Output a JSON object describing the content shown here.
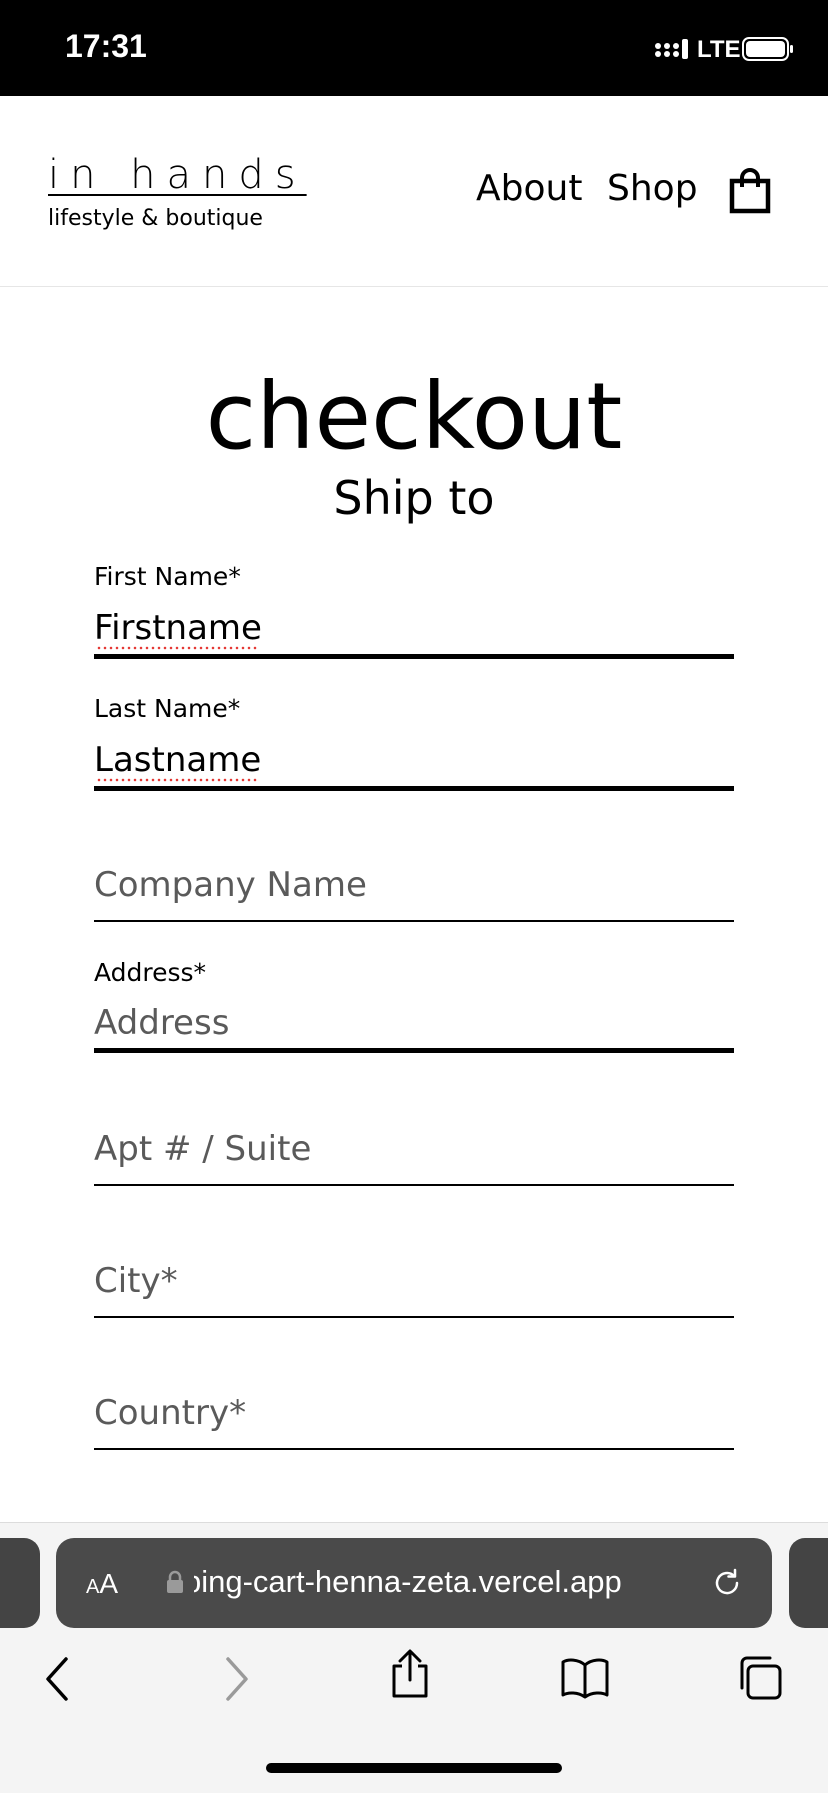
{
  "status_bar": {
    "time": "17:31",
    "network": "LTE"
  },
  "header": {
    "logo_title": "in hands",
    "logo_subtitle": "lifestyle & boutique",
    "nav": {
      "about": "About",
      "shop": "Shop"
    },
    "cart_icon": "shopping-bag-icon"
  },
  "main": {
    "title": "checkout",
    "subtitle": "Ship to",
    "fields": {
      "first_name": {
        "label": "First Name*",
        "value": "Firstname"
      },
      "last_name": {
        "label": "Last Name*",
        "value": "Lastname"
      },
      "company": {
        "placeholder": "Company Name"
      },
      "address": {
        "label": "Address*",
        "placeholder": "Address"
      },
      "apt": {
        "placeholder": "Apt # / Suite"
      },
      "city": {
        "placeholder": "City*"
      },
      "country": {
        "placeholder": "Country*"
      }
    }
  },
  "browser": {
    "aa_label": "AA",
    "url": "ping-cart-henna-zeta.vercel.app",
    "toolbar_icons": [
      "back-icon",
      "forward-icon",
      "share-icon",
      "bookmarks-icon",
      "tabs-icon"
    ]
  },
  "colors": {
    "status_bar_bg": "#000000",
    "spellcheck_underline": "#e53935",
    "url_bar_bg": "#4a4a4a"
  }
}
